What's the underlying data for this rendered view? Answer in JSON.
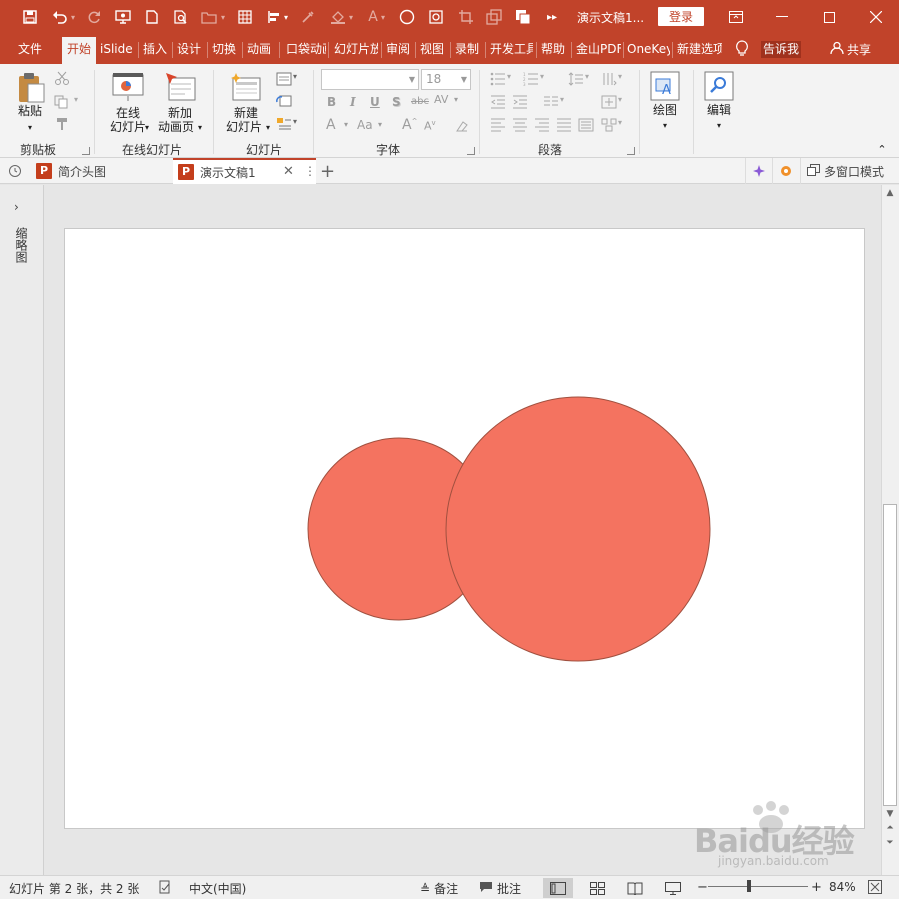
{
  "window": {
    "doc_title": "演示文稿1...",
    "login_label": "登录"
  },
  "colors": {
    "accent": "#c1432a",
    "shape_fill": "#f47360",
    "shape_stroke": "#a0503f"
  },
  "quick_access": [
    "save-icon",
    "undo-icon",
    "redo-icon",
    "slideshow-icon",
    "new-icon",
    "print-preview-icon",
    "open-icon",
    "table-icon",
    "align-icon",
    "eyedropper-icon",
    "fill-icon",
    "font-color-icon",
    "circle-shape-icon",
    "crop-icon",
    "copy-icon",
    "more-icon"
  ],
  "menu_tabs": [
    "文件",
    "开始",
    "iSlide",
    "插入",
    "设计",
    "切换",
    "动画",
    "口袋动画",
    "幻灯片放映",
    "审阅",
    "视图",
    "录制",
    "开发工具",
    "帮助",
    "金山PDF",
    "OneKey",
    "新建选项卡"
  ],
  "active_tab": "开始",
  "tell_me": "告诉我",
  "share_label": "共享",
  "ribbon": {
    "clipboard": {
      "paste": "粘贴",
      "group": "剪贴板"
    },
    "online_slides": {
      "online": "在线",
      "online2": "幻灯片",
      "new_anim": "新加",
      "new_anim2": "动画页",
      "group": "在线幻灯片"
    },
    "slides": {
      "new_slide": "新建",
      "new_slide2": "幻灯片",
      "group": "幻灯片"
    },
    "font": {
      "font_name": "",
      "font_size": "18",
      "group": "字体"
    },
    "paragraph": {
      "group": "段落"
    },
    "drawing": {
      "label": "绘图"
    },
    "editing": {
      "label": "编辑"
    }
  },
  "doc_tabs": {
    "tab1": "简介头图",
    "tab2": "演示文稿1",
    "multi_window": "多窗口模式"
  },
  "left_pane": {
    "label": "缩略图"
  },
  "status": {
    "slide_info": "幻灯片 第 2 张，共 2 张",
    "language": "中文(中国)",
    "notes": "备注",
    "comments": "批注",
    "zoom": "84%"
  },
  "watermark": {
    "brand": "Baidu经验",
    "url": "jingyan.baidu.com"
  }
}
